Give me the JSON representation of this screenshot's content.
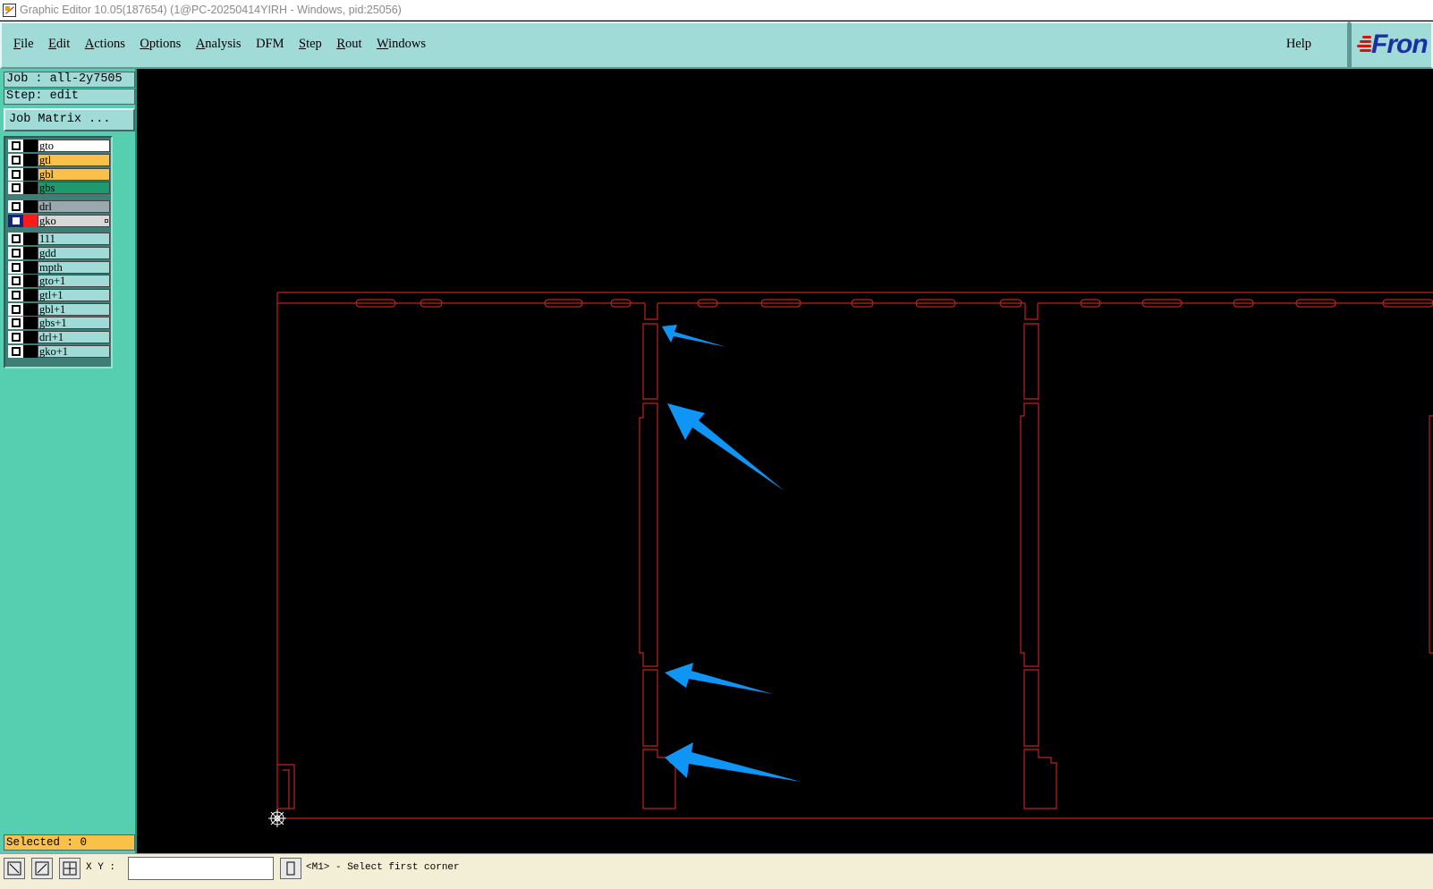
{
  "window": {
    "title": "Graphic Editor 10.05(187654) (1@PC-20250414YIRH - Windows, pid:25056)"
  },
  "menu": {
    "items": [
      {
        "label": "File",
        "key": "F",
        "rest": "ile"
      },
      {
        "label": "Edit",
        "key": "E",
        "rest": "dit"
      },
      {
        "label": "Actions",
        "key": "A",
        "rest": "ctions"
      },
      {
        "label": "Options",
        "key": "O",
        "rest": "ptions"
      },
      {
        "label": "Analysis",
        "key": "A",
        "rest": "nalysis"
      },
      {
        "label": "DFM",
        "key": "",
        "rest": "DFM"
      },
      {
        "label": "Step",
        "key": "S",
        "rest": "tep"
      },
      {
        "label": "Rout",
        "key": "R",
        "rest": "out"
      },
      {
        "label": "Windows",
        "key": "W",
        "rest": "indows"
      }
    ],
    "help": "Help"
  },
  "logo": {
    "text": "Fron"
  },
  "panel": {
    "job": "Job : all-2y7505",
    "step": "Step: edit",
    "job_matrix": "Job Matrix ...",
    "selected": "Selected : 0"
  },
  "layers": [
    {
      "name": "gto",
      "color": "#ffffff"
    },
    {
      "name": "gtl",
      "color": "#f9c14a"
    },
    {
      "name": "gbl",
      "color": "#f9c14a"
    },
    {
      "name": "gbs",
      "color": "#1e9a6e"
    },
    {
      "name": "drl",
      "color": "#9aa9b0"
    },
    {
      "name": "gko",
      "color": "#d8d8d8",
      "active": true
    },
    {
      "name": "111",
      "color": "#a0dbd8"
    },
    {
      "name": "gdd",
      "color": "#a0dbd8"
    },
    {
      "name": "mpth",
      "color": "#a0dbd8"
    },
    {
      "name": "gto+1",
      "color": "#a0dbd8"
    },
    {
      "name": "gtl+1",
      "color": "#a0dbd8"
    },
    {
      "name": "gbl+1",
      "color": "#a0dbd8"
    },
    {
      "name": "gbs+1",
      "color": "#a0dbd8"
    },
    {
      "name": "drl+1",
      "color": "#a0dbd8"
    },
    {
      "name": "gko+1",
      "color": "#a0dbd8"
    }
  ],
  "status": {
    "xy_label": "X Y :",
    "xy_value": "",
    "message": "<M1> - Select first corner"
  },
  "colors": {
    "outline": "#c0201e",
    "arrow": "#0f95f5",
    "active_color": "#ff1a1a"
  }
}
